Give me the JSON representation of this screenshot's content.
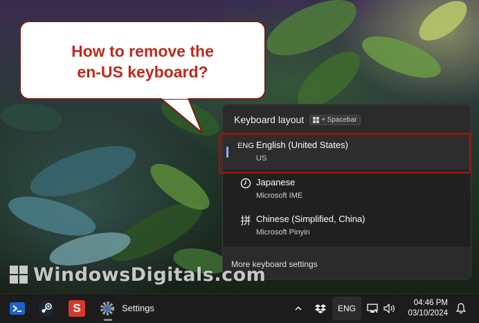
{
  "callout": {
    "line1": "How to remove the",
    "line2": "en-US keyboard?"
  },
  "flyout": {
    "title": "Keyboard layout",
    "shortcut_icon": "windows-key-icon",
    "shortcut_text": "+ Spacebar",
    "items": [
      {
        "icon_text": "ENG",
        "title": "English (United States)",
        "subtitle": "US",
        "selected": true
      },
      {
        "icon": "clock-ime-icon",
        "title": "Japanese",
        "subtitle": "Microsoft IME",
        "selected": false
      },
      {
        "icon_text": "拼",
        "title": "Chinese (Simplified, China)",
        "subtitle": "Microsoft Pinyin",
        "selected": false
      }
    ],
    "more_settings": "More keyboard settings"
  },
  "watermark": {
    "text": "WindowsDigitals.com"
  },
  "taskbar": {
    "apps": [
      {
        "name": "powershell-icon"
      },
      {
        "name": "steam-icon"
      },
      {
        "name": "sumatra-pdf-icon",
        "letter": "S"
      },
      {
        "name": "settings-gear-icon",
        "label": "Settings"
      }
    ],
    "tray": {
      "chevron": "^",
      "language": "ENG",
      "time": "04:46 PM",
      "date": "03/10/2024"
    }
  },
  "colors": {
    "callout_text": "#c0281a",
    "callout_border": "#7a1c12",
    "highlight_border": "#8b1a10",
    "selection_accent": "#8ab4f8",
    "flyout_bg": "#2b2b2b",
    "taskbar_bg": "#1c1c1c"
  }
}
